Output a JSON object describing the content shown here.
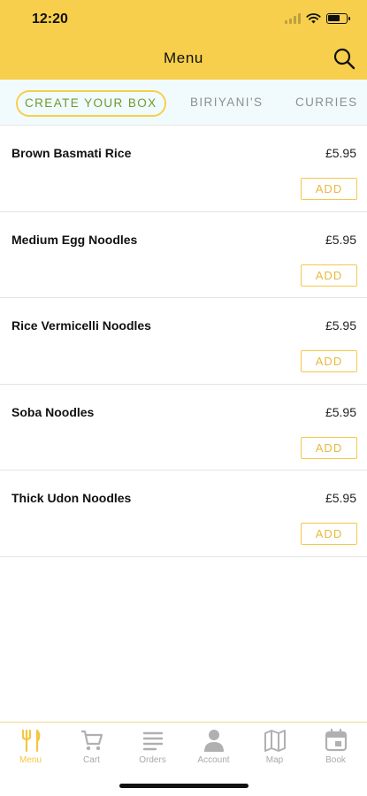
{
  "status_bar": {
    "time": "12:20",
    "icons": [
      "cellular-signal-icon",
      "wifi-icon",
      "battery-icon"
    ],
    "battery_level": 0.7
  },
  "header": {
    "title": "Menu",
    "search_icon": "search-icon",
    "background_color": "#f7cf4c"
  },
  "category_tabs": [
    {
      "label": "CREATE YOUR BOX",
      "selected": true
    },
    {
      "label": "BIRIYANI'S",
      "selected": false
    },
    {
      "label": "CURRIES",
      "selected": false
    }
  ],
  "menu_items": [
    {
      "name": "Brown Basmati Rice",
      "price": "£5.95",
      "button": "ADD"
    },
    {
      "name": "Medium Egg Noodles",
      "price": "£5.95",
      "button": "ADD"
    },
    {
      "name": "Rice Vermicelli Noodles",
      "price": "£5.95",
      "button": "ADD"
    },
    {
      "name": "Soba Noodles",
      "price": "£5.95",
      "button": "ADD"
    },
    {
      "name": "Thick Udon Noodles",
      "price": "£5.95",
      "button": "ADD"
    }
  ],
  "tab_bar": [
    {
      "label": "Menu",
      "icon": "fork-knife-icon",
      "active": true
    },
    {
      "label": "Cart",
      "icon": "cart-icon",
      "active": false
    },
    {
      "label": "Orders",
      "icon": "list-icon",
      "active": false
    },
    {
      "label": "Account",
      "icon": "person-icon",
      "active": false
    },
    {
      "label": "Map",
      "icon": "map-icon",
      "active": false
    },
    {
      "label": "Book",
      "icon": "calendar-icon",
      "active": false
    }
  ],
  "colors": {
    "accent": "#f7cf4c",
    "active_tab_text": "#6e9a2c",
    "inactive": "#a9a9a9"
  }
}
